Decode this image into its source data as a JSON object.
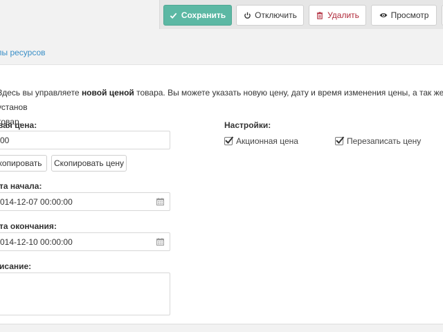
{
  "toolbar": {
    "save_label": "Сохранить",
    "disable_label": "Отключить",
    "delete_label": "Удалить",
    "preview_label": "Просмотр"
  },
  "breadcrumb": {
    "label": "пы ресурсов"
  },
  "intro": {
    "line1_start": "Здесь вы управляете ",
    "line1_bold": "новой ценой",
    "line1_end": " товара. Вы можете указать новую цену, дату и время изменения цены, а так же установ",
    "line2": "товар."
  },
  "form": {
    "new_price_label": "вая цена:",
    "new_price_value": "00",
    "copy_button": "копировать",
    "copy_price_button": "Скопировать цену",
    "start_date_label": "та начала:",
    "start_date_value": "014-12-07 00:00:00",
    "end_date_label": "та окончания:",
    "end_date_value": "014-12-10 00:00:00",
    "description_label": "исание:",
    "description_value": ""
  },
  "settings": {
    "label": "Настройки:",
    "promo_label": "Акционная цена",
    "promo_checked": true,
    "overwrite_label": "Перезаписать цену",
    "overwrite_checked": true
  },
  "icons": {
    "save": "check-icon",
    "disable": "power-icon",
    "delete": "trash-icon",
    "preview": "eye-icon",
    "calendar": "calendar-icon"
  },
  "colors": {
    "save_button": "#5cb8a4",
    "delete_text": "#b0293a",
    "link": "#3a8fc7"
  }
}
